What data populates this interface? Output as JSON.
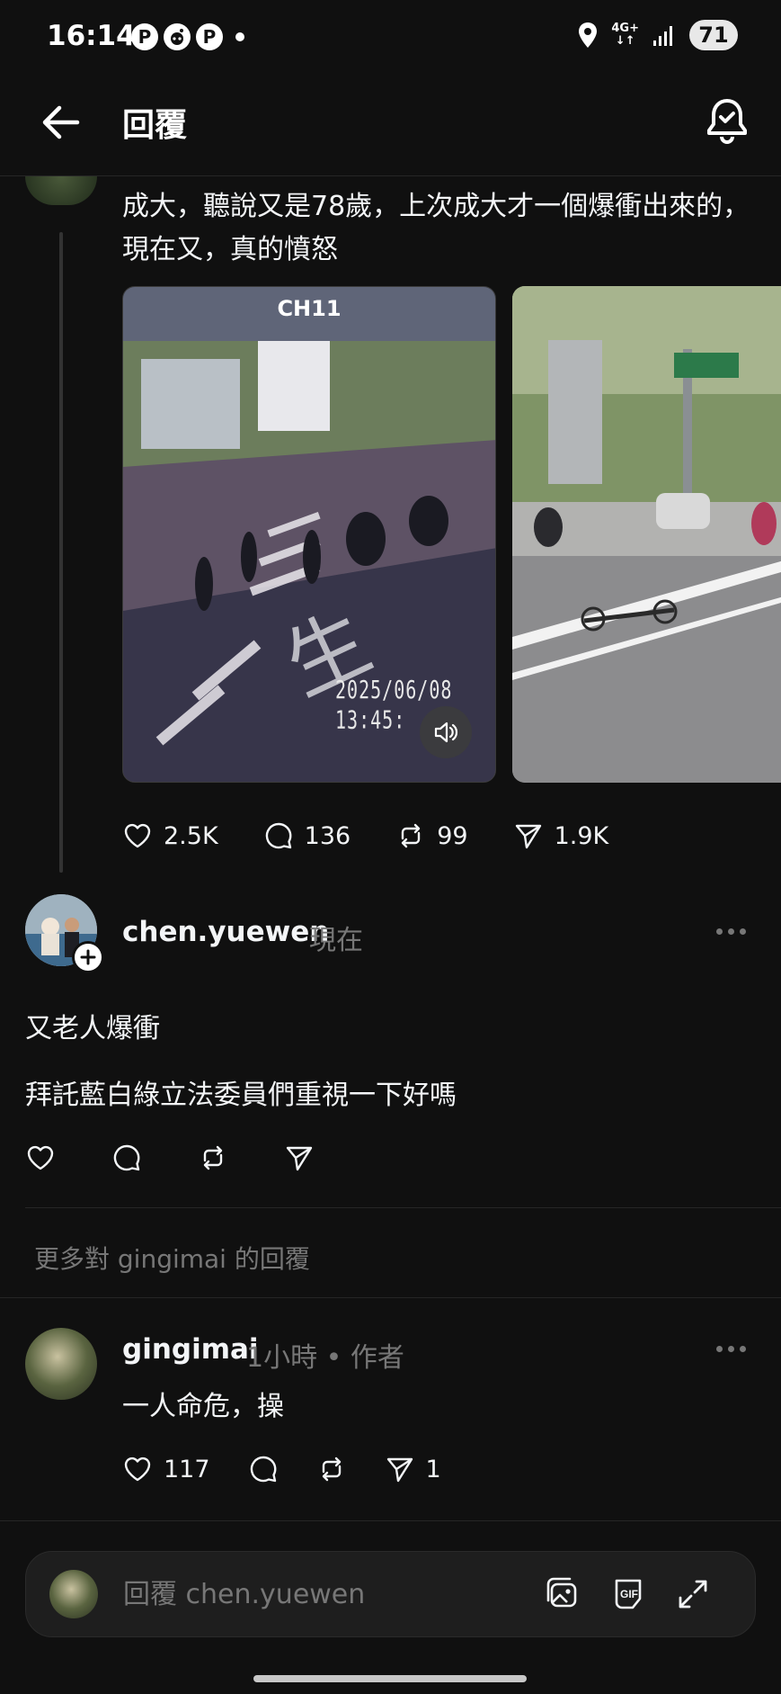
{
  "status_bar": {
    "time": "16:14",
    "left_icons": [
      "P",
      "reddit",
      "P"
    ],
    "network_label": "4G+",
    "battery": "71"
  },
  "header": {
    "title": "回覆"
  },
  "parent_post": {
    "text": "成大，聽說又是78歲，上次成大才一個爆衝出來的，現在又，真的憤怒",
    "media": [
      {
        "label": "CH11",
        "timestamp": "2025/06/08 13:45:"
      },
      {
        "label": ""
      }
    ],
    "stats": {
      "likes": "2.5K",
      "comments": "136",
      "reposts": "99",
      "shares": "1.9K"
    }
  },
  "reply": {
    "username": "chen.yuewen",
    "time": "現在",
    "line1": "又老人爆衝",
    "line2": "拜託藍白綠立法委員們重視一下好嗎"
  },
  "more_replies_label": "更多對 gingimai 的回覆",
  "author_reply": {
    "username": "gingimai",
    "meta": "1小時 • 作者",
    "text": "一人命危，操",
    "stats": {
      "likes": "117",
      "shares": "1"
    }
  },
  "composer": {
    "placeholder": "回覆 chen.yuewen",
    "gif_label": "GIF"
  },
  "colors": {
    "background": "#101010",
    "text_primary": "#f3f5f7",
    "text_secondary": "#777777",
    "divider": "#262626"
  }
}
